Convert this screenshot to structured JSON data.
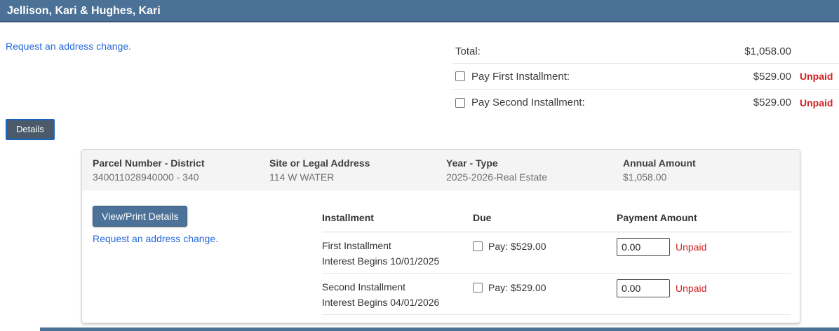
{
  "header": {
    "title": "Jellison, Kari & Hughes, Kari"
  },
  "links": {
    "address_change": "Request an address change."
  },
  "buttons": {
    "details": "Details",
    "view_print": "View/Print Details"
  },
  "summary": {
    "total_label": "Total:",
    "total_amount": "$1,058.00",
    "rows": [
      {
        "label": "Pay First Installment:",
        "amount": "$529.00",
        "status": "Unpaid"
      },
      {
        "label": "Pay Second Installment:",
        "amount": "$529.00",
        "status": "Unpaid"
      }
    ]
  },
  "parcel": {
    "columns": [
      {
        "label": "Parcel Number - District",
        "value": "340011028940000 - 340"
      },
      {
        "label": "Site or Legal Address",
        "value": "114 W WATER"
      },
      {
        "label": "Year - Type",
        "value": "2025-2026-Real Estate"
      },
      {
        "label": "Annual Amount",
        "value": "$1,058.00"
      }
    ],
    "table": {
      "headers": [
        "Installment",
        "Due",
        "Payment Amount"
      ],
      "rows": [
        {
          "name": "First Installment",
          "interest": "Interest Begins 10/01/2025",
          "pay_label": "Pay: $529.00",
          "payment_value": "0.00",
          "status": "Unpaid"
        },
        {
          "name": "Second Installment",
          "interest": "Interest Begins 04/01/2026",
          "pay_label": "Pay: $529.00",
          "payment_value": "0.00",
          "status": "Unpaid"
        }
      ]
    }
  },
  "colors": {
    "header_bar": "#4b7196",
    "link_blue": "#2569dd",
    "unpaid_red": "#d32121",
    "details_button_fill": "#4a5a6b",
    "details_button_border": "#1d64bb",
    "view_print_button": "#4d7299",
    "panel_header_bg": "#f4f4f4"
  }
}
